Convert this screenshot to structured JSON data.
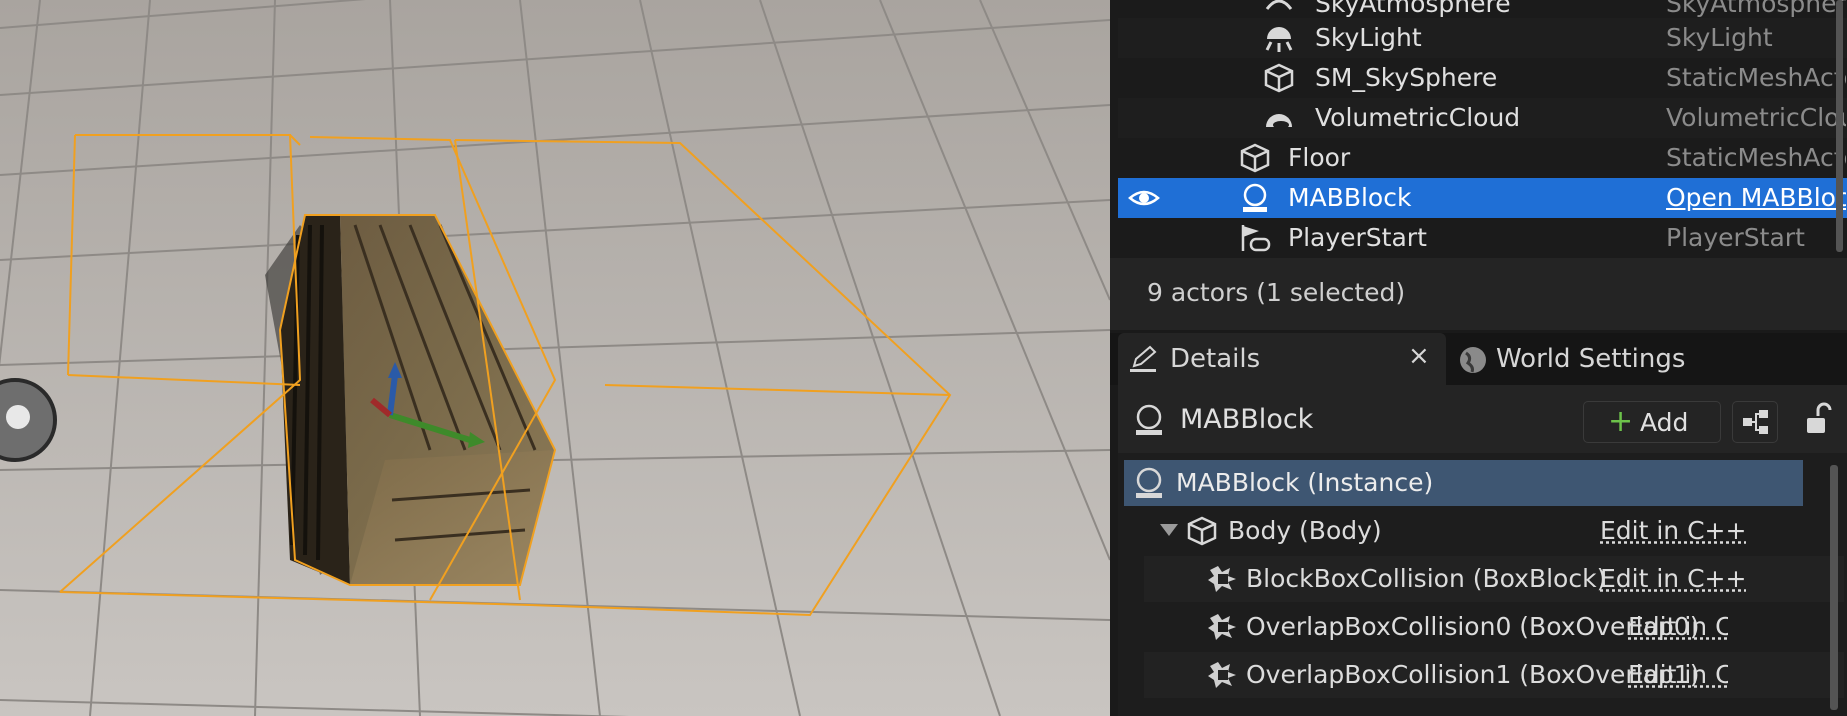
{
  "outliner": {
    "items": [
      {
        "label": "SkyAtmosphere",
        "type": "SkyAtmosphere",
        "icon": "sky-atmosphere-icon",
        "indent": 2
      },
      {
        "label": "SkyLight",
        "type": "SkyLight",
        "icon": "sky-light-icon",
        "indent": 2
      },
      {
        "label": "SM_SkySphere",
        "type": "StaticMeshActor",
        "icon": "static-mesh-icon",
        "indent": 2
      },
      {
        "label": "VolumetricCloud",
        "type": "VolumetricCloud",
        "icon": "volumetric-cloud-icon",
        "indent": 2
      },
      {
        "label": "Floor",
        "type": "StaticMeshActor",
        "icon": "static-mesh-icon",
        "indent": 1
      },
      {
        "label": "MABBlock",
        "type": "Open MABBlock",
        "icon": "actor-icon",
        "indent": 1,
        "selected": true
      },
      {
        "label": "PlayerStart",
        "type": "PlayerStart",
        "icon": "player-start-icon",
        "indent": 1
      }
    ],
    "status": "9 actors (1 selected)"
  },
  "details_tab": {
    "label": "Details",
    "close": "×",
    "world_settings_label": "World Settings"
  },
  "details": {
    "actor_name": "MABBlock",
    "add_label": "Add",
    "instance_label": "MABBlock (Instance)",
    "components": [
      {
        "label": "Body (Body)",
        "edit": "Edit in C++",
        "icon": "static-mesh-icon",
        "expanded": true
      },
      {
        "label": "BlockBoxCollision (BoxBlock)",
        "edit": "Edit in C++",
        "icon": "box-collision-icon"
      },
      {
        "label": "OverlapBoxCollision0 (BoxOverlap0)",
        "edit": "Edit in C++",
        "icon": "box-collision-icon"
      },
      {
        "label": "OverlapBoxCollision1 (BoxOverlap1)",
        "edit": "Edit in C++",
        "icon": "box-collision-icon"
      }
    ]
  },
  "colors": {
    "selection": "#1f6fd6",
    "instance_row": "#3e5672",
    "add_plus": "#6cc24a",
    "bounds_outline": "#f0a020"
  }
}
